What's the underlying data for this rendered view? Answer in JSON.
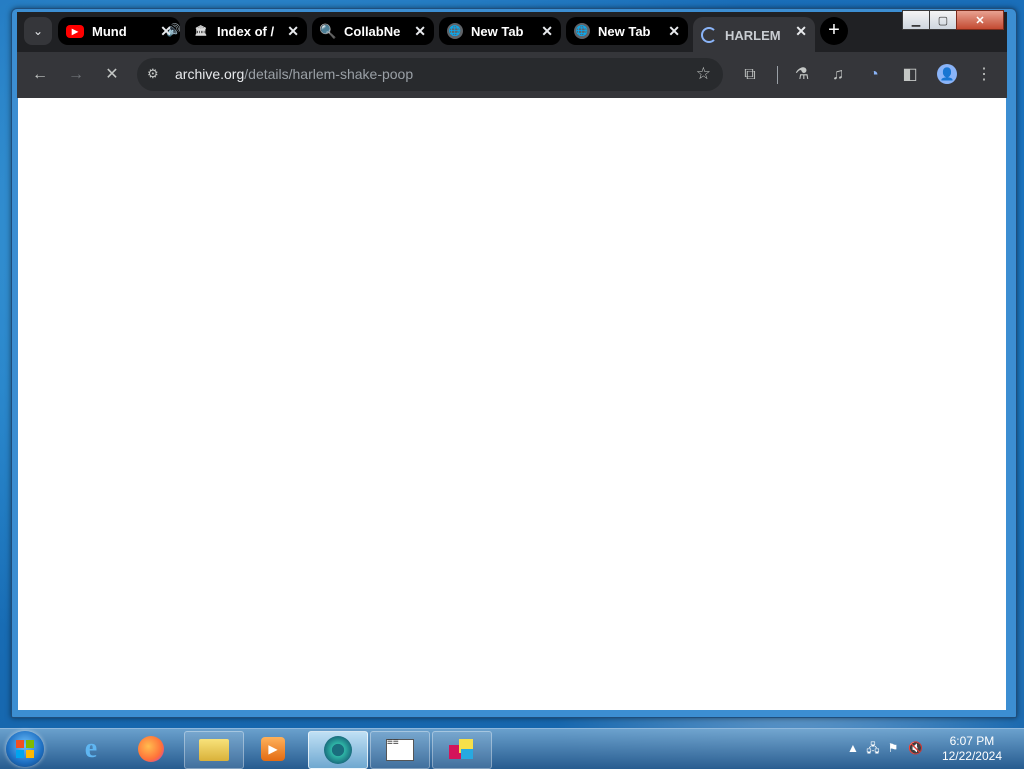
{
  "browser": {
    "tabs": [
      {
        "title": "Mundo",
        "favicon": "youtube-icon",
        "audible": true,
        "active": false
      },
      {
        "title": "Index of /",
        "favicon": "archive-icon",
        "active": false
      },
      {
        "title": "CollabNet",
        "favicon": "search-icon",
        "active": false
      },
      {
        "title": "New Tab",
        "favicon": "globe-icon",
        "active": false
      },
      {
        "title": "New Tab",
        "favicon": "globe-icon",
        "active": false
      },
      {
        "title": "HARLEM S",
        "favicon": "loading-icon",
        "active": true
      }
    ],
    "new_tab_label": "+",
    "close_symbol": "✕",
    "url_host": "archive.org",
    "url_path": "/details/harlem-shake-poop"
  },
  "taskbar": {
    "apps": [
      "internet-explorer",
      "firefox",
      "file-explorer",
      "media-player",
      "chrome-like",
      "notes",
      "paint"
    ],
    "time": "6:07 PM",
    "date": "12/22/2024"
  },
  "colors": {
    "chrome_bg": "#202124",
    "toolbar_bg": "#35363a",
    "omnibox_bg": "#282a2d"
  }
}
